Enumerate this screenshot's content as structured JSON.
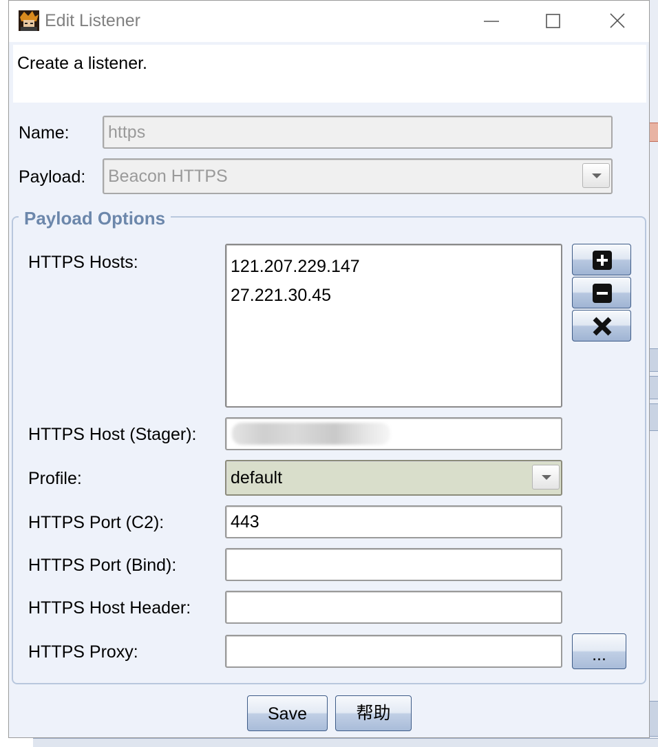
{
  "window": {
    "title": "Edit Listener",
    "description": "Create a listener."
  },
  "form": {
    "name_label": "Name:",
    "name_value": "https",
    "payload_label": "Payload:",
    "payload_value": "Beacon HTTPS"
  },
  "payload_options": {
    "group_title": "Payload Options",
    "hosts_label": "HTTPS Hosts:",
    "hosts": [
      "121.207.229.147",
      "27.221.30.45"
    ],
    "host_stager_label": "HTTPS Host (Stager):",
    "host_stager_value": "",
    "profile_label": "Profile:",
    "profile_value": "default",
    "port_c2_label": "HTTPS Port (C2):",
    "port_c2_value": "443",
    "port_bind_label": "HTTPS Port (Bind):",
    "port_bind_value": "",
    "host_header_label": "HTTPS Host Header:",
    "host_header_value": "",
    "proxy_label": "HTTPS Proxy:",
    "proxy_value": "",
    "proxy_browse_label": "..."
  },
  "buttons": {
    "save": "Save",
    "help": "帮助"
  },
  "icons": {
    "app": "cobalt-strike-app-icon",
    "add": "plus-icon",
    "remove": "minus-icon",
    "clear": "x-icon"
  },
  "colors": {
    "window_bg": "#eef2fa",
    "group_title": "#6c87ab",
    "profile_bg": "#d9decb",
    "button_border": "#3c5a86"
  }
}
